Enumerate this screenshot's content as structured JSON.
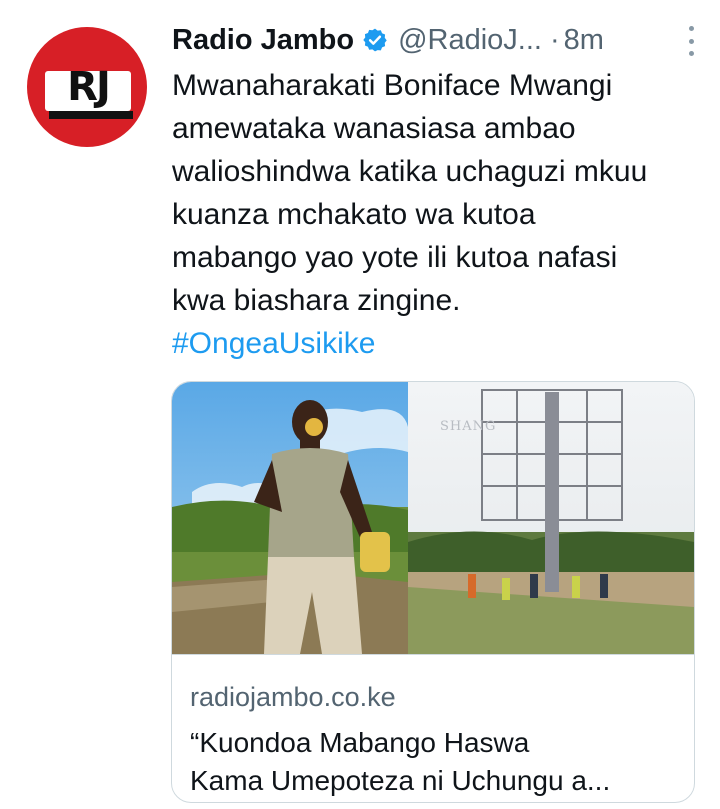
{
  "avatar": {
    "logo_text": "RJ",
    "color": "#d71f26"
  },
  "header": {
    "name": "Radio Jambo",
    "handle": "@RadioJ...",
    "separator": "·",
    "time": "8m"
  },
  "tweet": {
    "lines": [
      "Mwanaharakati Boniface Mwangi",
      "amewataka wanasiasa ambao",
      "walioshindwa katika uchaguzi mkuu",
      "kuanza mchakato wa kutoa",
      "mabango yao yote ili kutoa nafasi",
      "kwa biashara zingine."
    ],
    "hashtag": "#OngeaUsikike"
  },
  "card": {
    "watermark": "SHANG",
    "domain": "radiojambo.co.ke",
    "title_lines": [
      "“Kuondoa Mabango Haswa",
      "Kama Umepoteza ni Uchungu a..."
    ]
  },
  "colors": {
    "link": "#1d9bf0",
    "verified": "#1d9bf0",
    "secondary_text": "#536471",
    "border": "#cfd9de"
  }
}
